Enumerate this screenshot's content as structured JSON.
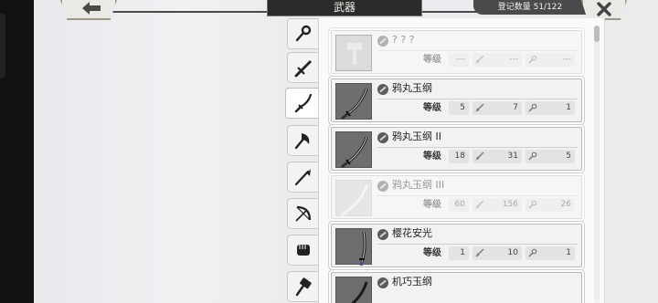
{
  "header": {
    "title": "武器",
    "registered_label": "登记数量 51/122"
  },
  "tabs": [
    {
      "name": "tab-accessory",
      "icon": "rope-icon",
      "active": false
    },
    {
      "name": "tab-sword",
      "icon": "broadsword-icon",
      "active": false
    },
    {
      "name": "tab-katana",
      "icon": "katana-icon",
      "active": true
    },
    {
      "name": "tab-axe",
      "icon": "axe-icon",
      "active": false
    },
    {
      "name": "tab-spear",
      "icon": "spear-icon",
      "active": false
    },
    {
      "name": "tab-bow",
      "icon": "bow-icon",
      "active": false
    },
    {
      "name": "tab-gauntlet",
      "icon": "fist-icon",
      "active": false
    },
    {
      "name": "tab-hammer",
      "icon": "hammer-icon",
      "active": false
    }
  ],
  "items": [
    {
      "name": "? ? ?",
      "level_label": "等级",
      "level": "---",
      "attack": "---",
      "crit": "---",
      "state": "unknown"
    },
    {
      "name": "鸦丸玉纲",
      "level_label": "等级",
      "level": "5",
      "attack": "7",
      "crit": "1",
      "state": "owned"
    },
    {
      "name": "鸦丸玉纲 II",
      "level_label": "等级",
      "level": "18",
      "attack": "31",
      "crit": "5",
      "state": "owned"
    },
    {
      "name": "鸦丸玉纲 III",
      "level_label": "等级",
      "level": "60",
      "attack": "156",
      "crit": "26",
      "state": "dim"
    },
    {
      "name": "樱花安光",
      "level_label": "等级",
      "level": "1",
      "attack": "10",
      "crit": "1",
      "state": "owned"
    },
    {
      "name": "机巧玉纲",
      "level_label": "",
      "level": "",
      "attack": "",
      "crit": "",
      "state": "owned"
    }
  ]
}
